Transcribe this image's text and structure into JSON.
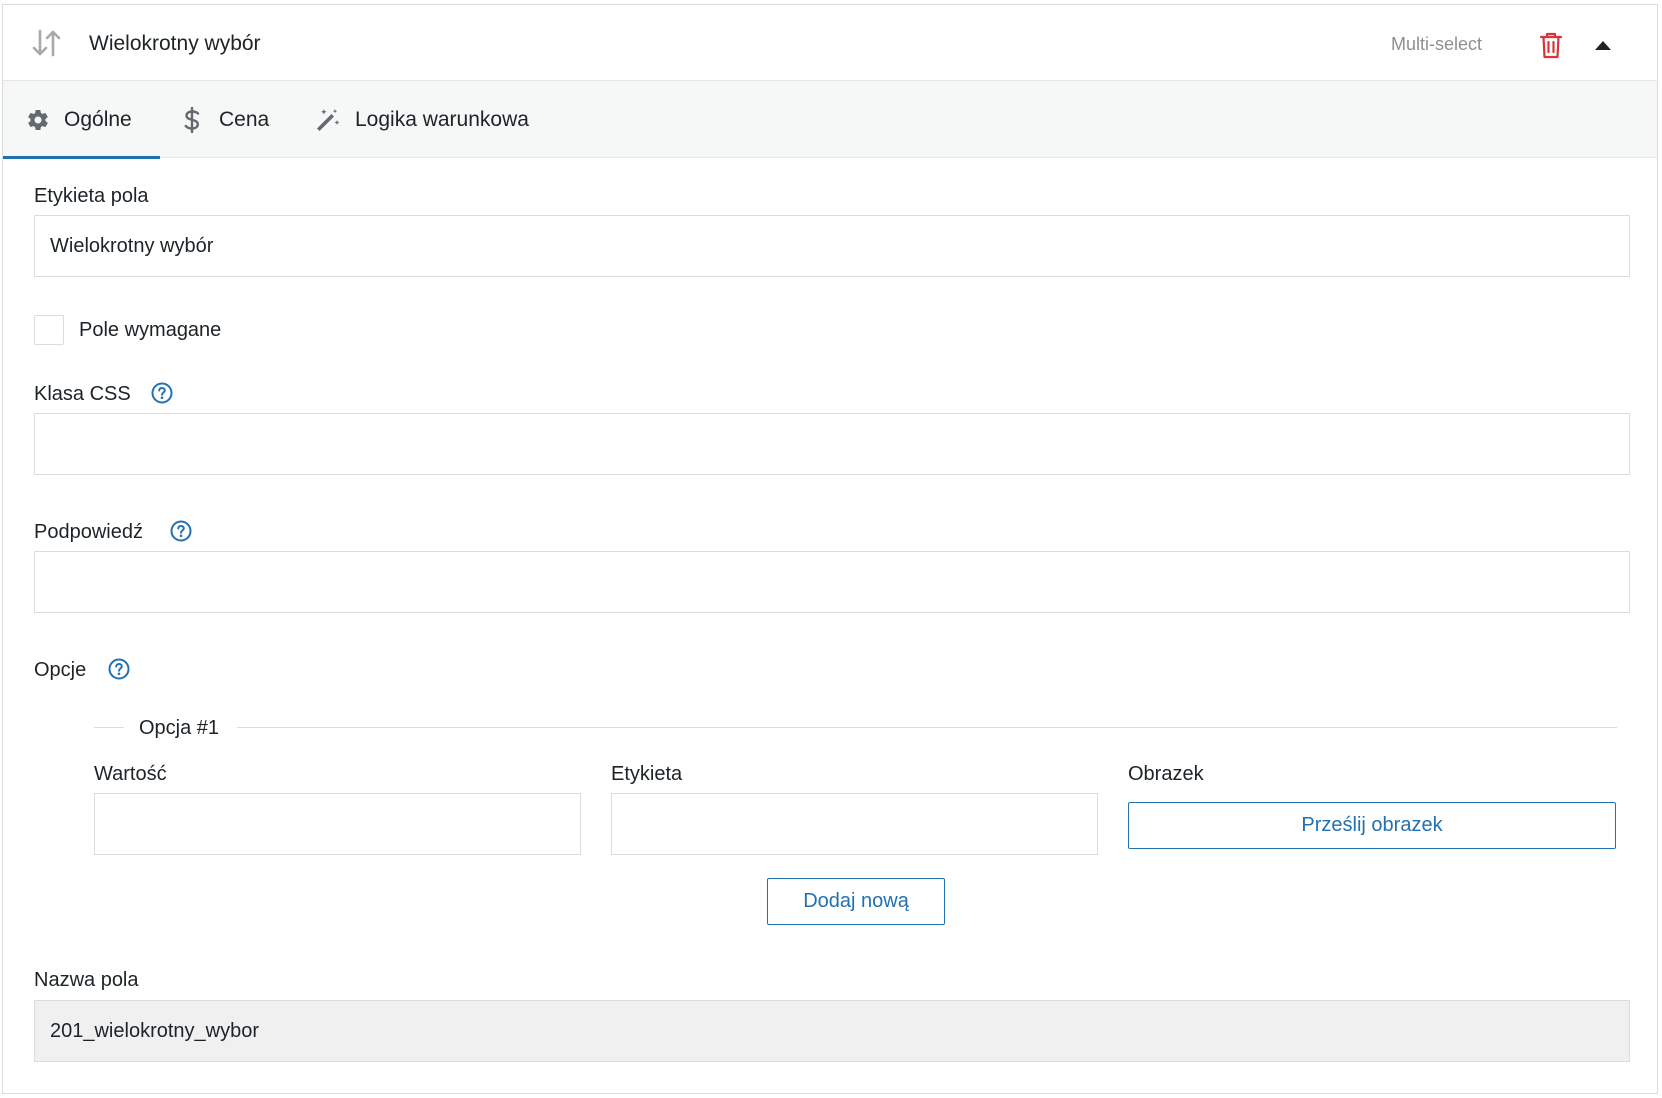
{
  "header": {
    "title": "Wielokrotny wybór",
    "field_type": "Multi-select",
    "sort_icon": "sort-arrows-icon",
    "delete_icon": "trash-icon",
    "collapse_icon": "caret-up-icon"
  },
  "tabs": [
    {
      "label": "Ogólne",
      "icon": "gear-icon",
      "active": true
    },
    {
      "label": "Cena",
      "icon": "dollar-icon",
      "active": false
    },
    {
      "label": "Logika warunkowa",
      "icon": "magic-wand-icon",
      "active": false
    }
  ],
  "form": {
    "field_label": {
      "label": "Etykieta pola",
      "value": "Wielokrotny wybór"
    },
    "required": {
      "label": "Pole wymagane",
      "checked": false
    },
    "css_class": {
      "label": "Klasa CSS",
      "value": ""
    },
    "hint": {
      "label": "Podpowiedź",
      "value": ""
    },
    "options": {
      "label": "Opcje",
      "items": [
        {
          "legend": "Opcja #1",
          "value_label": "Wartość",
          "value": "",
          "label_label": "Etykieta",
          "label_value": "",
          "image_label": "Obrazek",
          "upload_button": "Prześlij obrazek"
        }
      ],
      "add_button": "Dodaj nową"
    },
    "field_name": {
      "label": "Nazwa pola",
      "value": "201_wielokrotny_wybor"
    }
  },
  "colors": {
    "accent": "#2271b1",
    "danger": "#d63638",
    "muted": "#8c8f94",
    "tabs_bg": "#f6f7f7",
    "readonly_bg": "#f0f0f1"
  }
}
